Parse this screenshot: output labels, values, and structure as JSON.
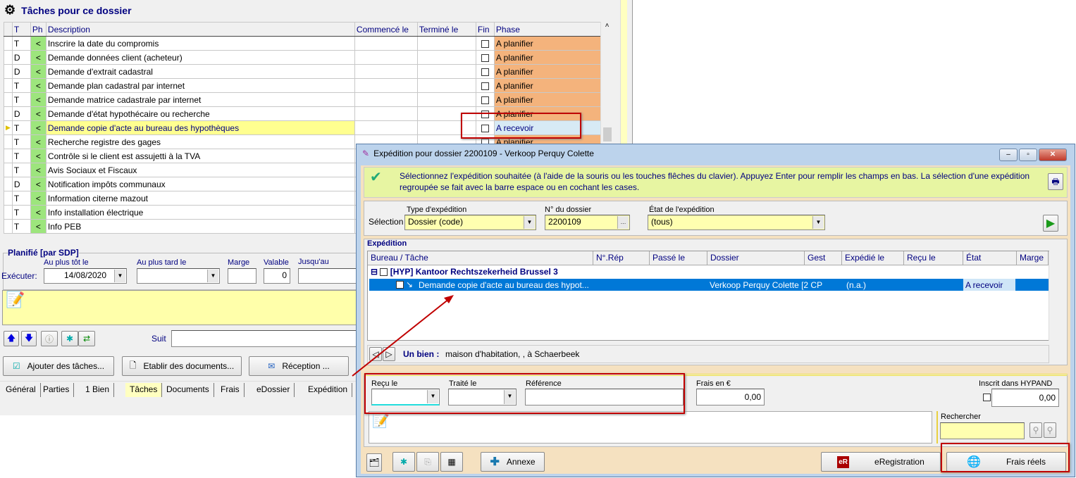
{
  "tasks_panel": {
    "title": "Tâches pour ce dossier",
    "columns": [
      "T",
      "Ph",
      "Description",
      "Commencé le",
      "Terminé le",
      "Fin",
      "Phase"
    ],
    "rows": [
      {
        "t": "T",
        "ph": "<",
        "description": "Inscrire la date du compromis",
        "phase": "A planifier"
      },
      {
        "t": "D",
        "ph": "<",
        "description": "Demande données client (acheteur)",
        "phase": "A planifier"
      },
      {
        "t": "D",
        "ph": "<",
        "description": "Demande d'extrait cadastral",
        "phase": "A planifier"
      },
      {
        "t": "T",
        "ph": "<",
        "description": "Demande plan cadastral par internet",
        "phase": "A planifier"
      },
      {
        "t": "T",
        "ph": "<",
        "description": "Demande matrice cadastrale par internet",
        "phase": "A planifier"
      },
      {
        "t": "D",
        "ph": "<",
        "description": "Demande d'état hypothécaire ou recherche",
        "phase": "A planifier"
      },
      {
        "t": "T",
        "ph": "<",
        "description": "Demande copie d'acte au bureau des hypothèques",
        "phase": "A recevoir",
        "selected": true
      },
      {
        "t": "T",
        "ph": "<",
        "description": "Recherche registre des gages",
        "phase": "A planifier"
      },
      {
        "t": "T",
        "ph": "<",
        "description": "Contrôle si le client est assujetti à la TVA",
        "phase": ""
      },
      {
        "t": "T",
        "ph": "<",
        "description": "Avis Sociaux et Fiscaux",
        "phase": ""
      },
      {
        "t": "D",
        "ph": "<",
        "description": "Notification impôts communaux",
        "phase": ""
      },
      {
        "t": "T",
        "ph": "<",
        "description": "Information citerne mazout",
        "phase": ""
      },
      {
        "t": "T",
        "ph": "<",
        "description": "Info installation électrique",
        "phase": ""
      },
      {
        "t": "T",
        "ph": "<",
        "description": "Info PEB",
        "phase": ""
      }
    ],
    "planned": {
      "title": "Planifié  [par SDP]",
      "execute_label": "Exécuter:",
      "earliest_label": "Au plus tôt le",
      "earliest_value": "14/08/2020",
      "latest_label": "Au plus tard le",
      "latest_value": "",
      "margin_label": "Marge",
      "margin_value": "",
      "valid_label": "Valable",
      "valid_value": "0",
      "until_label": "Jusqu'au",
      "until_value": ""
    },
    "suit_label": "Suit",
    "buttons": {
      "add_tasks": "Ajouter des tâches...",
      "make_docs": "Etablir des documents...",
      "reception": "Réception ..."
    },
    "tabs": [
      "Général",
      "Parties",
      "1 Bien",
      "Tâches",
      "Documents",
      "Frais",
      "eDossier",
      "Expédition"
    ],
    "active_tab": "Tâches"
  },
  "dialog": {
    "title": "Expédition pour dossier 2200109 - Verkoop Perquy Colette",
    "info": "Sélectionnez l'expédition souhaitée (à l'aide de la souris ou les touches flêches du clavier). Appuyez Enter pour remplir les champs en bas. La sélection d'une expédition regroupée se fait avec la barre espace ou en cochant les cases.",
    "selection": {
      "label": "Sélection",
      "type_label": "Type d'expédition",
      "type_value": "Dossier (code)",
      "dossier_label": "N° du dossier",
      "dossier_value": "2200109",
      "state_label": "État de l'expédition",
      "state_value": "(tous)"
    },
    "expedition": {
      "group_label": "Expédition",
      "columns": [
        "Bureau / Tâche",
        "N°.Rép",
        "Passé le",
        "Dossier",
        "Gest",
        "Expédié le",
        "Reçu le",
        "État",
        "Marge"
      ],
      "group_row": "[HYP] Kantoor Rechtszekerheid Brussel 3",
      "row": {
        "task": "Demande copie d'acte au bureau des hypot...",
        "dossier": "Verkoop Perquy Colette [2 CP",
        "expedie": "(n.a.)",
        "etat": "A recevoir"
      },
      "bien_label": "Un bien :",
      "bien_value": "maison d'habitation, , à Schaerbeek"
    },
    "fields": {
      "recu_label": "Reçu le",
      "recu_value": "",
      "traite_label": "Traité le",
      "traite_value": "",
      "ref_label": "Référence",
      "ref_value": "",
      "frais_label": "Frais en €",
      "frais_value": "0,00",
      "hypand_label": "Inscrit dans HYPAND",
      "hypand_value": "0,00",
      "search_label": "Rechercher",
      "search_value": ""
    },
    "buttons": {
      "annexe": "Annexe",
      "eregistration": "eRegistration",
      "eregistration_badge": "eR",
      "frais_reels": "Frais réels"
    }
  },
  "colors": {
    "phase_plan": "#f4b37c",
    "phase_recv": "#d7eaf5",
    "ph_green": "#9de57d",
    "highlight": "#c00000",
    "selection": "#0078d7"
  }
}
